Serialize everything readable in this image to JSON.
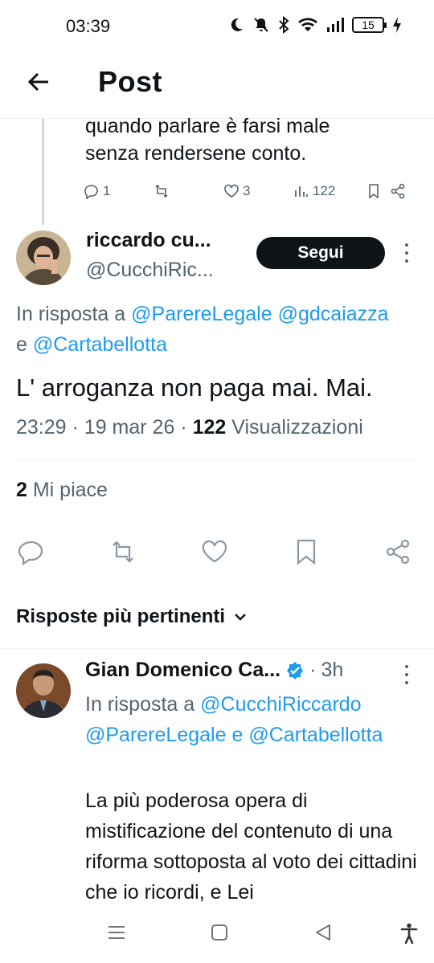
{
  "status_bar": {
    "time": "03:39",
    "battery": "15",
    "icons": [
      "moon-icon",
      "mute-icon",
      "bluetooth-icon",
      "wifi-icon",
      "signal-icon",
      "battery-icon",
      "charging-icon"
    ]
  },
  "header": {
    "title": "Post",
    "back_icon": "arrow-left-icon"
  },
  "previous_tweet": {
    "text_line1": "quando parlare è farsi male",
    "text_line2": "senza rendersene conto.",
    "replies": "1",
    "retweets": "",
    "likes": "3",
    "views": "122"
  },
  "main_tweet": {
    "name": "riccardo cu...",
    "handle": "@CucchiRic...",
    "follow_label": "Segui",
    "reply_prefix": "In risposta a",
    "mention1": "@ParereLegale",
    "mention2": "@gdcaiazza",
    "conj": "e",
    "mention3": "@Cartabellotta",
    "text": "L' arroganza non paga mai. Mai.",
    "time": "23:29",
    "sep": "·",
    "date": "19 mar 26",
    "views_count": "122",
    "views_label": "Visualizzazioni",
    "likes_count": "2",
    "likes_label": "Mi piace"
  },
  "sort": {
    "label": "Risposte più pertinenti"
  },
  "reply_tweet": {
    "name": "Gian Domenico Ca...",
    "verified": true,
    "time": "3h",
    "sep": "·",
    "reply_prefix": "In risposta a",
    "mention1": "@CucchiRiccardo",
    "mention2": "@ParereLegale",
    "conj": "e",
    "mention3": "@Cartabellotta",
    "text": "La più poderosa opera di mistificazione del contenuto di una riforma sottoposta al voto dei cittadini che io ricordi, e Lei"
  },
  "colors": {
    "accent": "#1d9bf0",
    "text": "#0f1419",
    "secondary": "#536471",
    "follow_bg": "#0f1419"
  }
}
